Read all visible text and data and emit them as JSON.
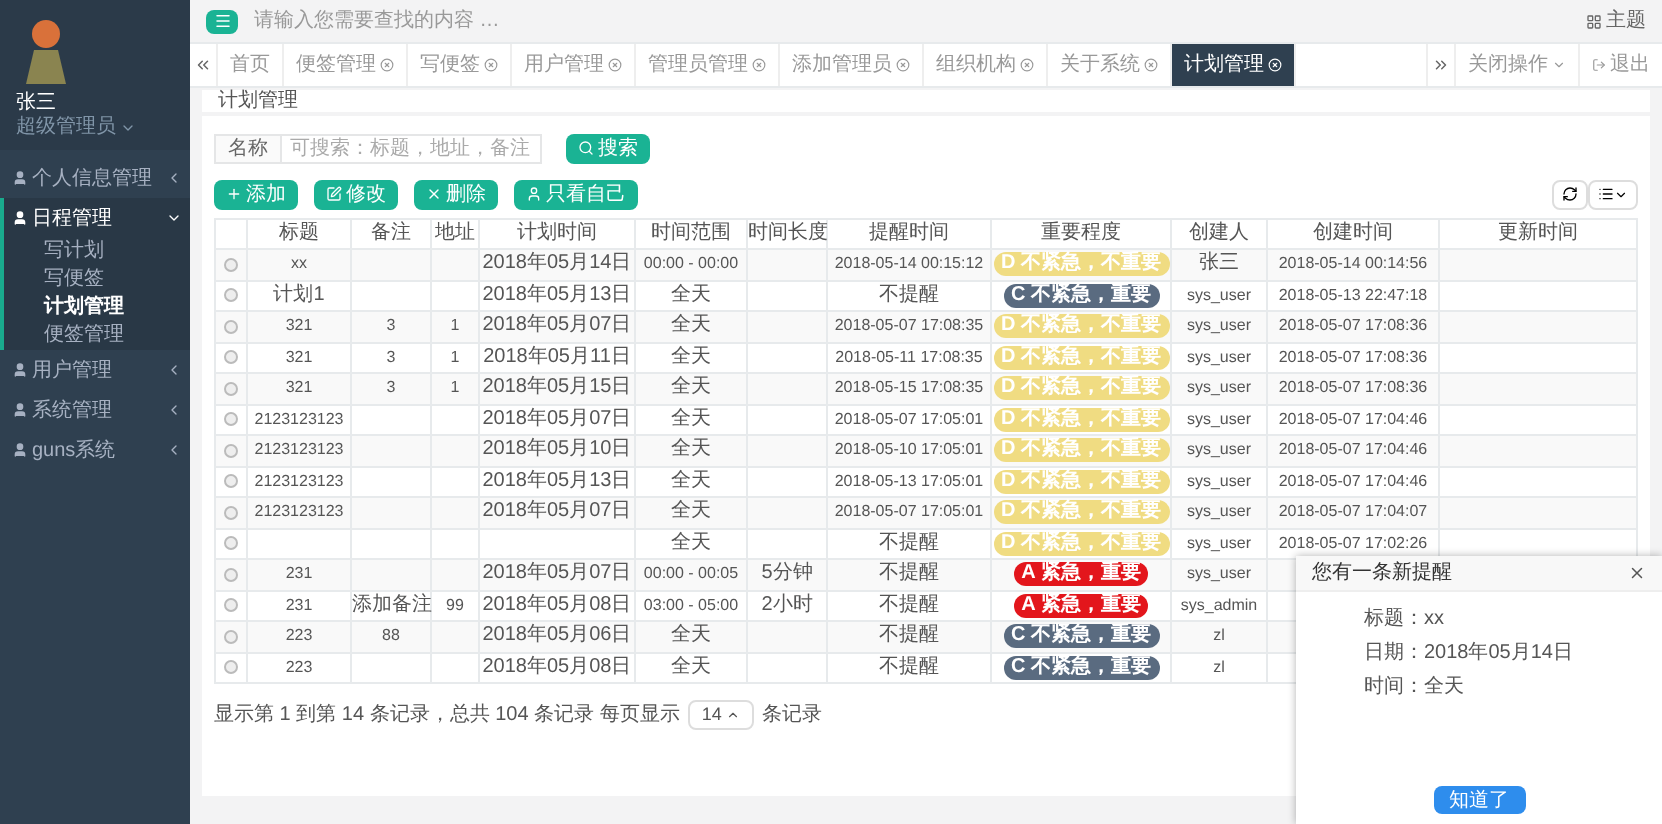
{
  "sidebar": {
    "user": {
      "name": "张三",
      "role": "超级管理员"
    },
    "menu": [
      {
        "label": "个人信息管理",
        "expanded": false
      },
      {
        "label": "日程管理",
        "expanded": true,
        "children": [
          {
            "label": "写计划",
            "selected": false
          },
          {
            "label": "写便签",
            "selected": false
          },
          {
            "label": "计划管理",
            "selected": true
          },
          {
            "label": "便签管理",
            "selected": false
          }
        ]
      },
      {
        "label": "用户管理",
        "expanded": false
      },
      {
        "label": "系统管理",
        "expanded": false
      },
      {
        "label": "guns系统",
        "expanded": false
      }
    ]
  },
  "topbar": {
    "search_placeholder": "请输入您需要查找的内容 …",
    "theme": "主题"
  },
  "tabs": [
    {
      "label": "首页",
      "closable": false,
      "selected": false
    },
    {
      "label": "便签管理",
      "closable": true,
      "selected": false
    },
    {
      "label": "写便签",
      "closable": true,
      "selected": false
    },
    {
      "label": "用户管理",
      "closable": true,
      "selected": false
    },
    {
      "label": "管理员管理",
      "closable": true,
      "selected": false
    },
    {
      "label": "添加管理员",
      "closable": true,
      "selected": false
    },
    {
      "label": "组织机构",
      "closable": true,
      "selected": false
    },
    {
      "label": "关于系统",
      "closable": true,
      "selected": false
    },
    {
      "label": "计划管理",
      "closable": true,
      "selected": true
    }
  ],
  "tab_actions": {
    "close_menu": "关闭操作",
    "logout": "退出"
  },
  "breadcrumb": "计划管理",
  "search": {
    "label": "名称",
    "placeholder": "可搜索：标题，地址，备注",
    "button": "搜索"
  },
  "toolbar": [
    {
      "kind": "add",
      "label": "添加"
    },
    {
      "kind": "edit",
      "label": "修改"
    },
    {
      "kind": "delete",
      "label": "删除"
    },
    {
      "kind": "mine",
      "label": "只看自己"
    }
  ],
  "table": {
    "columns": [
      "标题",
      "备注",
      "地址",
      "计划时间",
      "时间范围",
      "时间长度",
      "提醒时间",
      "重要程度",
      "创建人",
      "创建时间",
      "更新时间"
    ],
    "rows": [
      {
        "selected": false,
        "title": "xx",
        "date": "2018年05月14日",
        "range": "00:00 - 00:00",
        "remind": "2018-05-14 00:15:12",
        "importance": {
          "text": "D 不紧急，不重要",
          "color": "#f0dc82"
        },
        "creator": "张三",
        "created": "2018-05-14 00:14:56"
      },
      {
        "selected": false,
        "title": "计划1",
        "date": "2018年05月13日",
        "range": "全天",
        "remind": "不提醒",
        "importance": {
          "text": "C 不紧急，重要",
          "color": "#5a6b80"
        },
        "creator": "sys_user",
        "created": "2018-05-13 22:47:18"
      },
      {
        "selected": false,
        "title": "321",
        "note": "3",
        "address": "1",
        "date": "2018年05月07日",
        "range": "全天",
        "remind": "2018-05-07 17:08:35",
        "importance": {
          "text": "D 不紧急，不重要",
          "color": "#f0dc82"
        },
        "creator": "sys_user",
        "created": "2018-05-07 17:08:36"
      },
      {
        "selected": false,
        "title": "321",
        "note": "3",
        "address": "1",
        "date": "2018年05月11日",
        "range": "全天",
        "remind": "2018-05-11 17:08:35",
        "importance": {
          "text": "D 不紧急，不重要",
          "color": "#f0dc82"
        },
        "creator": "sys_user",
        "created": "2018-05-07 17:08:36"
      },
      {
        "selected": false,
        "title": "321",
        "note": "3",
        "address": "1",
        "date": "2018年05月15日",
        "range": "全天",
        "remind": "2018-05-15 17:08:35",
        "importance": {
          "text": "D 不紧急，不重要",
          "color": "#f0dc82"
        },
        "creator": "sys_user",
        "created": "2018-05-07 17:08:36"
      },
      {
        "selected": false,
        "title": "2123123123",
        "date": "2018年05月07日",
        "range": "全天",
        "remind": "2018-05-07 17:05:01",
        "importance": {
          "text": "D 不紧急，不重要",
          "color": "#f0dc82"
        },
        "creator": "sys_user",
        "created": "2018-05-07 17:04:46"
      },
      {
        "selected": false,
        "title": "2123123123",
        "date": "2018年05月10日",
        "range": "全天",
        "remind": "2018-05-10 17:05:01",
        "importance": {
          "text": "D 不紧急，不重要",
          "color": "#f0dc82"
        },
        "creator": "sys_user",
        "created": "2018-05-07 17:04:46"
      },
      {
        "selected": false,
        "title": "2123123123",
        "date": "2018年05月13日",
        "range": "全天",
        "remind": "2018-05-13 17:05:01",
        "importance": {
          "text": "D 不紧急，不重要",
          "color": "#f0dc82"
        },
        "creator": "sys_user",
        "created": "2018-05-07 17:04:46"
      },
      {
        "selected": false,
        "title": "2123123123",
        "date": "2018年05月07日",
        "range": "全天",
        "remind": "2018-05-07 17:05:01",
        "importance": {
          "text": "D 不紧急，不重要",
          "color": "#f0dc82"
        },
        "creator": "sys_user",
        "created": "2018-05-07 17:04:07"
      },
      {
        "selected": false,
        "range": "全天",
        "remind": "不提醒",
        "importance": {
          "text": "D 不紧急，不重要",
          "color": "#f0dc82"
        },
        "creator": "sys_user",
        "created": "2018-05-07 17:02:26"
      },
      {
        "selected": false,
        "title": "231",
        "date": "2018年05月07日",
        "range": "00:00 - 00:05",
        "duration": "5分钟",
        "remind": "不提醒",
        "importance": {
          "text": "A 紧急，重要",
          "color": "#e3161c"
        },
        "creator": "sys_user"
      },
      {
        "selected": false,
        "title": "231",
        "note": "添加备注",
        "address": "99",
        "date": "2018年05月08日",
        "range": "03:00 - 05:00",
        "duration": "2小时",
        "remind": "不提醒",
        "importance": {
          "text": "A 紧急，重要",
          "color": "#e3161c"
        },
        "creator": "sys_admin"
      },
      {
        "selected": false,
        "title": "223",
        "note": "88",
        "date": "2018年05月06日",
        "range": "全天",
        "remind": "不提醒",
        "importance": {
          "text": "C 不紧急，重要",
          "color": "#5a6b80"
        },
        "creator": "zl"
      },
      {
        "selected": false,
        "title": "223",
        "date": "2018年05月08日",
        "range": "全天",
        "remind": "不提醒",
        "importance": {
          "text": "C 不紧急，重要",
          "color": "#5a6b80"
        },
        "creator": "zl"
      }
    ]
  },
  "pagination": {
    "summary": "显示第 1 到第 14 条记录，总共 104 条记录 每页显示",
    "page_size": "14",
    "suffix": "条记录"
  },
  "popup": {
    "title": "您有一条新提醒",
    "lines": [
      "标题：xx",
      "日期：2018年05月14日",
      "时间：全天"
    ],
    "button": "知道了"
  }
}
